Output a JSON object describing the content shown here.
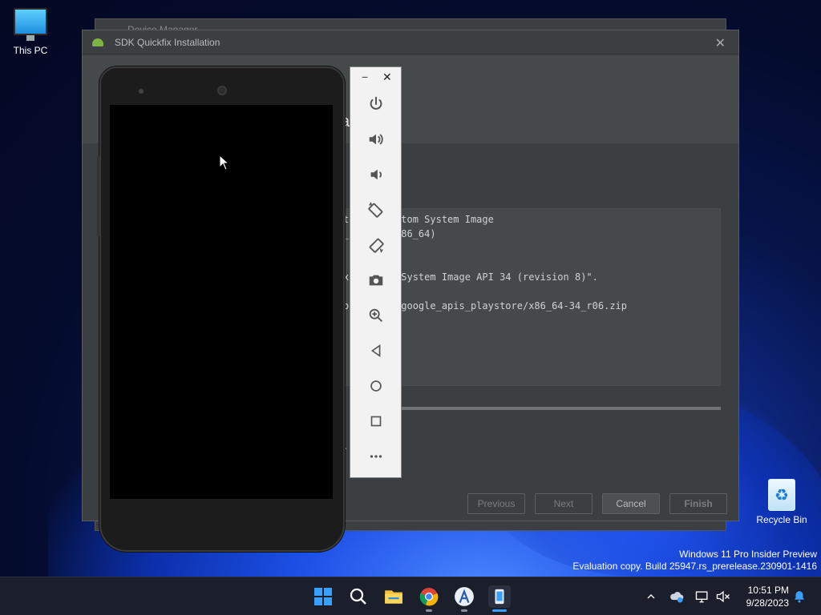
{
  "desktop": {
    "icons": [
      {
        "label": "This PC",
        "icon": "this-pc-icon"
      },
      {
        "label": "Recycle Bin",
        "icon": "recycle-bin-icon"
      }
    ],
    "watermark": {
      "line1": "Windows 11 Pro Insider Preview",
      "line2": "Evaluation copy. Build 25947.rs_prerelease.230901-1416"
    }
  },
  "back_window": {
    "title": "Device Manager"
  },
  "dialog": {
    "title": "SDK Quickfix Installation",
    "header_fragment": "a",
    "log_lines": [
      "t      4 Atom System Image",
      "_      e;x86_64)",
      "x      om System Image API 34 (revision 8)\".",
      "o      mg/google_apis_playstore/x86_64-34_r06.zip"
    ],
    "status_fragment": "d.",
    "progress": 1.0,
    "buttons": {
      "previous": "Previous",
      "next": "Next",
      "cancel": "Cancel",
      "finish": "Finish"
    }
  },
  "emulator_toolbar": {
    "minimize": "−",
    "close": "✕",
    "controls": [
      "power-icon",
      "volume-up-icon",
      "volume-down-icon",
      "rotate-left-icon",
      "rotate-right-icon",
      "camera-icon",
      "zoom-icon",
      "back-icon",
      "home-icon",
      "overview-icon",
      "more-icon"
    ]
  },
  "taskbar": {
    "apps": [
      "start-icon",
      "search-icon",
      "file-explorer-icon",
      "chrome-icon",
      "android-studio-icon",
      "emulator-icon"
    ],
    "clock": {
      "time": "10:51 PM",
      "date": "9/28/2023"
    }
  },
  "colors": {
    "dialog_bg": "#3c3f41",
    "dialog_header": "#45494a",
    "taskbar": "#1a1f2b",
    "accent": "#1c50e6"
  }
}
